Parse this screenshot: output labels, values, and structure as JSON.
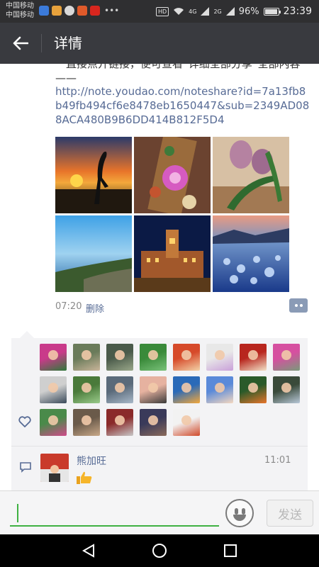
{
  "status_bar": {
    "carrier_1": "中国移动",
    "carrier_2": "中国移动",
    "network_hd": "HD",
    "signal_1": "4G",
    "signal_2": "2G",
    "battery": "96%",
    "battery_level": 0.96,
    "time": "23:39"
  },
  "app_bar": {
    "title": "详情",
    "back_icon": "arrow-left-icon"
  },
  "post": {
    "text_cut": "一直接点开链接，便可查看“详细全部分享”全部内容——",
    "link": "http://note.youdao.com/noteshare?id=7a13fb8b49fb494cf6e8478eb1650447&sub=2349AD088ACA480B9B6DD414B812F5D4",
    "time": "07:20",
    "delete_label": "删除",
    "photos": [
      "sunset-crane-photo",
      "pink-flowers-tray-photo",
      "tulips-photo",
      "coastal-town-photo",
      "night-palace-photo",
      "ice-lake-photo"
    ]
  },
  "likes": {
    "heart_icon": "heart-icon",
    "avatars": [
      "avatar-1",
      "avatar-2",
      "avatar-3",
      "avatar-4",
      "avatar-5",
      "avatar-6",
      "avatar-7",
      "avatar-8",
      "avatar-9",
      "avatar-10",
      "avatar-11",
      "avatar-12",
      "avatar-13",
      "avatar-14",
      "avatar-15",
      "avatar-16",
      "avatar-17",
      "avatar-18",
      "avatar-19",
      "avatar-20",
      "avatar-21"
    ]
  },
  "comment": {
    "name": "熊加旺",
    "time": "11:01",
    "content_icon": "thumbs-up-icon"
  },
  "input_bar": {
    "placeholder": "",
    "send_label": "发送"
  },
  "colors": {
    "link": "#576b95",
    "appbar": "#393a3f",
    "accent_green": "#3fb142",
    "panel_bg": "#f3f3f5"
  }
}
